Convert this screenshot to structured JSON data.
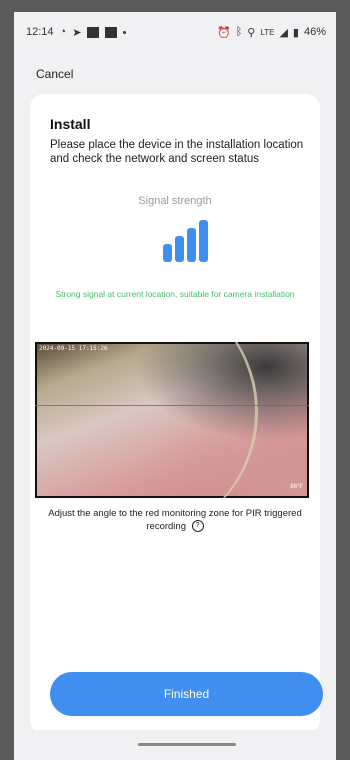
{
  "status_bar": {
    "time": "12:14",
    "signal_text": "LTE",
    "battery": "46%"
  },
  "header": {
    "cancel_label": "Cancel"
  },
  "install": {
    "title": "Install",
    "description": "Please place the device in the installation location and check the network and screen status",
    "signal_label": "Signal strength",
    "signal_bars": 4,
    "signal_status": "Strong signal at current location, suitable for camera installation"
  },
  "camera": {
    "timestamp": "2024-09-15 17:15:26",
    "temperature": "86°F"
  },
  "pir": {
    "instruction": "Adjust the angle to the red monitoring zone for PIR triggered recording"
  },
  "footer": {
    "finish_label": "Finished"
  },
  "colors": {
    "accent": "#3f8ef0",
    "success": "#45c06a"
  }
}
